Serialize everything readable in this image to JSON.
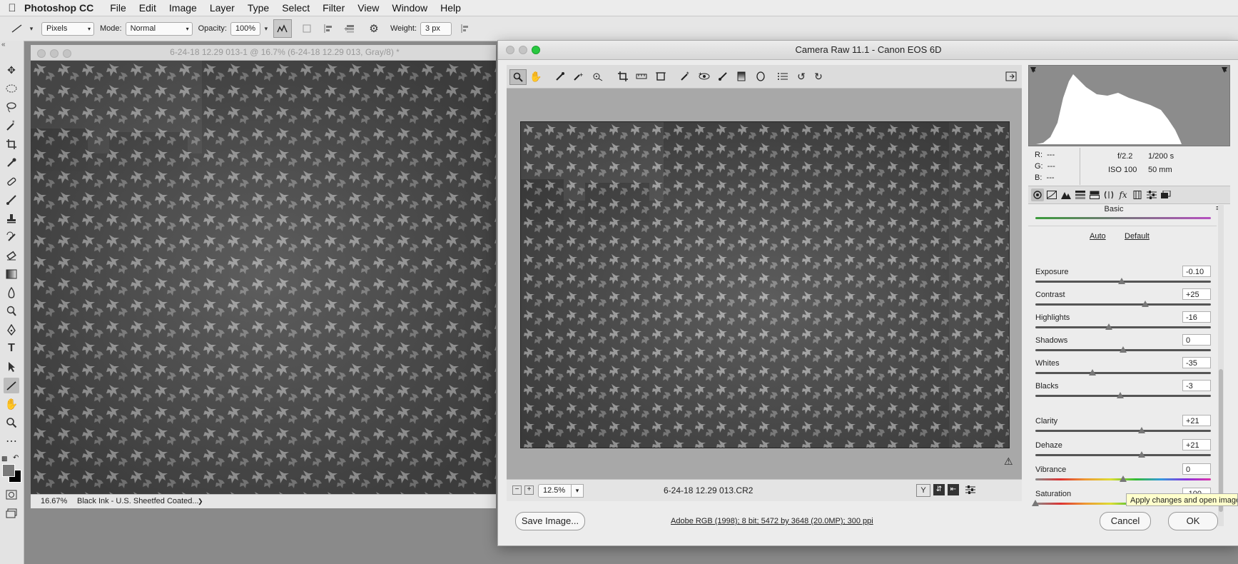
{
  "menubar": {
    "app_name": "Photoshop CC",
    "items": [
      "File",
      "Edit",
      "Image",
      "Layer",
      "Type",
      "Select",
      "Filter",
      "View",
      "Window",
      "Help"
    ]
  },
  "options_bar": {
    "pixels_select": "Pixels",
    "mode_label": "Mode:",
    "mode_value": "Normal",
    "opacity_label": "Opacity:",
    "opacity_value": "100%",
    "weight_label": "Weight:",
    "weight_value": "3 px"
  },
  "document": {
    "title": "6-24-18 12.29 013-1 @ 16.7% (6-24-18 12.29 013, Gray/8) *",
    "zoom": "16.67%",
    "profile": "Black Ink - U.S. Sheetfed Coated...",
    "status_arrow": "❯"
  },
  "camera_raw": {
    "title": "Camera Raw 11.1  -  Canon EOS 6D",
    "zoom": "12.5%",
    "filename": "6-24-18 12.29 013.CR2",
    "readout": {
      "r_label": "R:",
      "r_value": "---",
      "g_label": "G:",
      "g_value": "---",
      "b_label": "B:",
      "b_value": "---",
      "aperture": "f/2.2",
      "shutter": "1/200 s",
      "iso": "ISO 100",
      "focal": "50 mm"
    },
    "panel_title": "Basic",
    "auto_label": "Auto",
    "default_label": "Default",
    "sliders": [
      {
        "label": "Exposure",
        "value": "-0.10",
        "pos": 0.49
      },
      {
        "label": "Contrast",
        "value": "+25",
        "pos": 0.625
      },
      {
        "label": "Highlights",
        "value": "-16",
        "pos": 0.42
      },
      {
        "label": "Shadows",
        "value": "0",
        "pos": 0.5
      },
      {
        "label": "Whites",
        "value": "-35",
        "pos": 0.325
      },
      {
        "label": "Blacks",
        "value": "-3",
        "pos": 0.485
      },
      {
        "label": "Clarity",
        "value": "+21",
        "pos": 0.605
      },
      {
        "label": "Dehaze",
        "value": "+21",
        "pos": 0.605
      },
      {
        "label": "Vibrance",
        "value": "0",
        "pos": 0.5
      },
      {
        "label": "Saturation",
        "value": "-100",
        "pos": 0.0
      }
    ],
    "save_button": "Save Image...",
    "workflow_link": "Adobe RGB (1998); 8 bit; 5472 by 3648 (20.0MP); 300 ppi",
    "cancel_button": "Cancel",
    "ok_button": "OK",
    "tooltip": "Apply changes and open image"
  }
}
